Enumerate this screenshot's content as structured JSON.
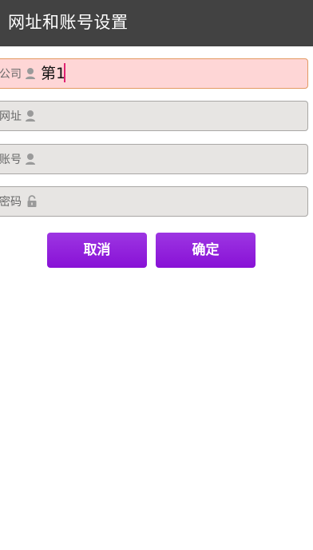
{
  "header": {
    "title": "网址和账号设置"
  },
  "form": {
    "fields": [
      {
        "label": "公司",
        "value": "第1",
        "icon": "person-icon"
      },
      {
        "label": "网址",
        "value": "",
        "icon": "person-icon"
      },
      {
        "label": "账号",
        "value": "",
        "icon": "person-icon"
      },
      {
        "label": "密码",
        "value": "",
        "icon": "lock-icon"
      }
    ]
  },
  "actions": {
    "cancel_label": "取消",
    "confirm_label": "确定"
  },
  "colors": {
    "titlebar_bg": "#424242",
    "active_field_bg": "#fed6d6",
    "field_bg": "#e7e5e3",
    "button_purple": "#9124dc",
    "caret": "#e02373"
  }
}
